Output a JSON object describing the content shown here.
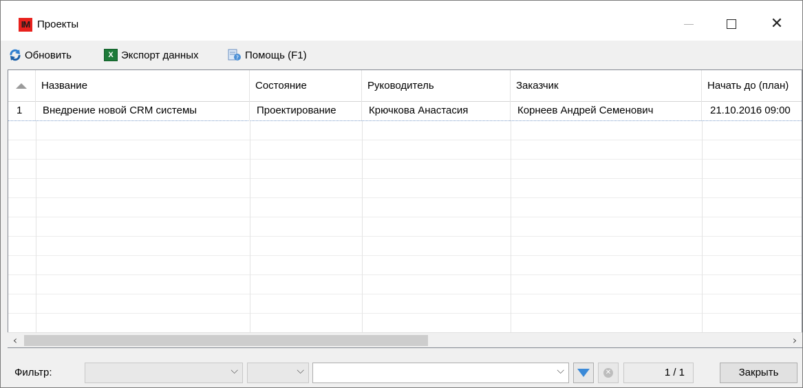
{
  "window": {
    "logo_text": "IM",
    "title": "Проекты",
    "close_glyph": "✕"
  },
  "toolbar": {
    "refresh_label": "Обновить",
    "export_label": "Экспорт данных",
    "help_label": "Помощь (F1)",
    "excel_icon_text": "X"
  },
  "grid": {
    "columns": [
      "Название",
      "Состояние",
      "Руководитель",
      "Заказчик",
      "Начать до (план)"
    ],
    "rows": [
      {
        "num": "1",
        "name": "Внедрение новой CRM системы",
        "state": "Проектирование",
        "manager": "Крючкова Анастасия",
        "customer": "Корнеев Андрей Семенович",
        "start_plan": "21.10.2016 09:00"
      }
    ]
  },
  "scrollbar": {
    "left_glyph": "‹",
    "right_glyph": "›",
    "thumb_fraction": 0.53
  },
  "filterbar": {
    "filter_label": "Фильтр:",
    "combo1_value": "",
    "combo2_value": "",
    "combo3_value": "",
    "chevron_glyph": "⌵",
    "clear_glyph": "✕",
    "page_counter": "1 / 1",
    "close_label": "Закрыть"
  },
  "colors": {
    "logo_bg": "#e8211d",
    "excel_green": "#1e7b3a",
    "filter_blue": "#3b8ad8"
  }
}
